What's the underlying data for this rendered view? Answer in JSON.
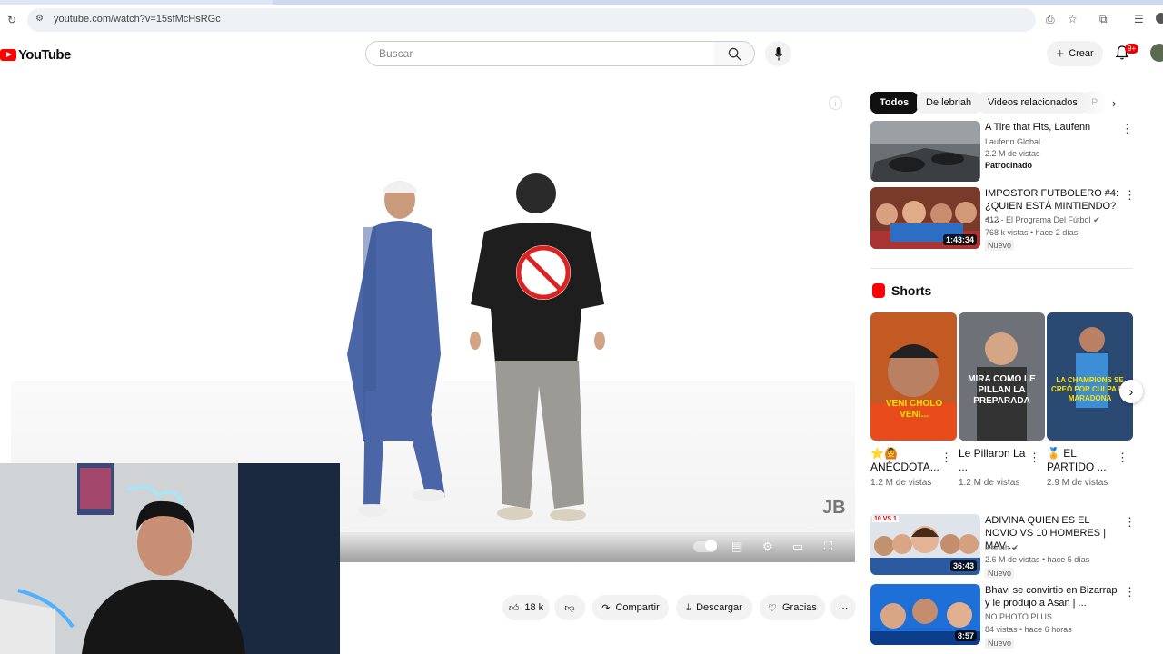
{
  "browser": {
    "url": "youtube.com/watch?v=15sfMcHsRGc"
  },
  "header": {
    "logo_text": "YouTube",
    "search_placeholder": "Buscar",
    "create_label": "Crear",
    "notifications_badge": "9+"
  },
  "player": {
    "watermark": "JB"
  },
  "actions": {
    "likes": "18 k",
    "share": "Compartir",
    "download": "Descargar",
    "thanks": "Gracias"
  },
  "chips": [
    "Todos",
    "De lebriah",
    "Videos relacionados",
    "P"
  ],
  "sidebar": {
    "videos_top": [
      {
        "title": "A Tire that Fits, Laufenn",
        "channel": "Laufenn Global",
        "views": "2.2 M de vistas",
        "badge": "Patrocinado"
      },
      {
        "title": "IMPOSTOR FUTBOLERO #4: ¿QUIEN ESTÁ MINTIENDO? - ...",
        "channel": "412 - El Programa Del Fútbol",
        "views": "768 k vistas • hace 2 días",
        "badge": "Nuevo",
        "duration": "1:43:34"
      }
    ],
    "shorts_heading": "Shorts",
    "shorts": [
      {
        "title": "⭐🙆 ANÉCDOTA...",
        "views": "1.2 M de vistas",
        "caption": "VENI CHOLO VENI..."
      },
      {
        "title": "Le Pillaron La ...",
        "views": "1.2 M de vistas",
        "caption": "MIRA COMO LE PILLAN LA PREPARADA"
      },
      {
        "title": "🏅 EL PARTIDO ...",
        "views": "2.9 M de vistas",
        "caption": "LA CHAMPIONS SE CREÓ POR CULPA DE MARADONA"
      }
    ],
    "videos_bottom": [
      {
        "title": "ADIVINA QUIEN ES EL NOVIO VS 10 HOMBRES | MAV ...",
        "channel": "lebriah",
        "views": "2.6 M de vistas • hace 5 días",
        "badge": "Nuevo",
        "duration": "36:43",
        "thumb_label": "10 VS 1"
      },
      {
        "title": "Bhavi se convirtio en Bizarrap y le produjo a Asan | ...",
        "channel": "NO PHOTO PLUS",
        "views": "84 vistas • hace 6 horas",
        "badge": "Nuevo",
        "duration": "8:57"
      }
    ]
  }
}
